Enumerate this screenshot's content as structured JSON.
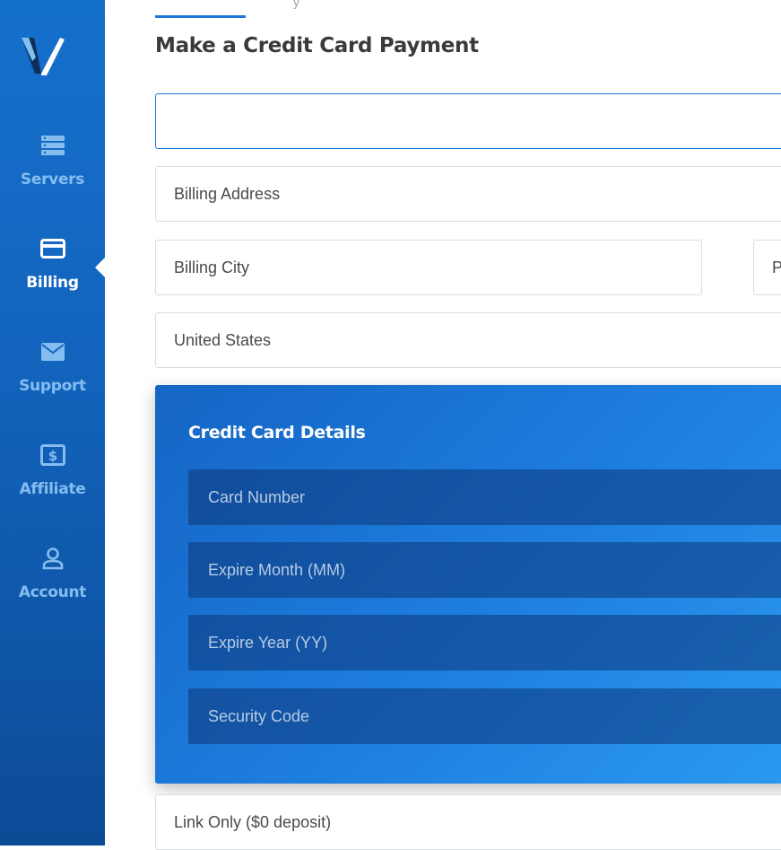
{
  "sidebar": {
    "items": [
      {
        "label": "Servers",
        "icon": "servers-icon"
      },
      {
        "label": "Billing",
        "icon": "credit-card-icon",
        "active": true
      },
      {
        "label": "Support",
        "icon": "envelope-icon"
      },
      {
        "label": "Affiliate",
        "icon": "dollar-icon"
      },
      {
        "label": "Account",
        "icon": "user-icon"
      }
    ]
  },
  "page": {
    "title": "Make a Credit Card Payment"
  },
  "form": {
    "name_placeholder": "",
    "billing_address_placeholder": "Billing Address",
    "billing_city_placeholder": "Billing City",
    "postal_placeholder": "P",
    "country_value": "United States",
    "deposit_value": "Link Only ($0 deposit)"
  },
  "card": {
    "title": "Credit Card Details",
    "card_number_placeholder": "Card Number",
    "expire_month_placeholder": "Expire Month (MM)",
    "expire_year_placeholder": "Expire Year (YY)",
    "security_code_placeholder": "Security Code"
  },
  "colors": {
    "sidebar_blue": "#1263bc",
    "accent": "#1b78d8",
    "card_panel": "#1e7fe0"
  }
}
